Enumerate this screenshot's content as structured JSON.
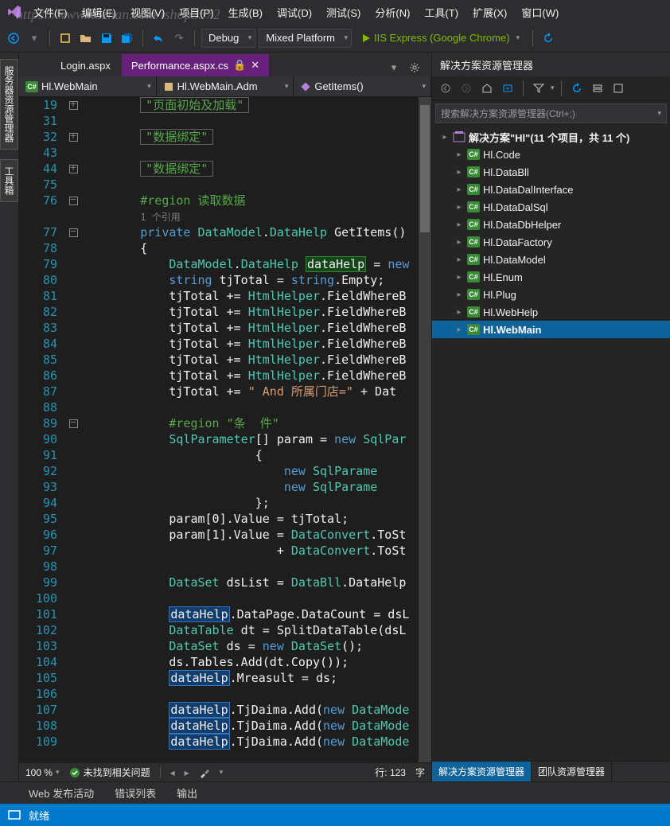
{
  "watermark": "https://www.huzhan.com/ishop3572",
  "menus": [
    "文件(F)",
    "编辑(E)",
    "视图(V)",
    "项目(P)",
    "生成(B)",
    "调试(D)",
    "测试(S)",
    "分析(N)",
    "工具(T)",
    "扩展(X)",
    "窗口(W)"
  ],
  "toolbar": {
    "config": "Debug",
    "platform": "Mixed Platform",
    "run_label": "IIS Express (Google Chrome)"
  },
  "left_rail": [
    "服务器资源管理器",
    "工具箱"
  ],
  "doc_tabs": [
    {
      "label": "Login.aspx",
      "active": false
    },
    {
      "label": "Performance.aspx.cs",
      "active": true
    }
  ],
  "nav": {
    "project": "Hl.WebMain",
    "class": "Hl.WebMain.Adm",
    "member": "GetItems()"
  },
  "editor_status": {
    "zoom": "100 %",
    "issues": "未找到相关问题",
    "line_label": "行:",
    "line": "123",
    "col_label": "字"
  },
  "bottom_tabs": [
    "Web 发布活动",
    "错误列表",
    "输出"
  ],
  "status": "就绪",
  "solution": {
    "title": "解决方案资源管理器",
    "search_placeholder": "搜索解决方案资源管理器(Ctrl+;)",
    "root": "解决方案\"Hl\"(11 个项目，共 11 个)",
    "projects": [
      "Hl.Code",
      "Hl.DataBll",
      "Hl.DataDalInterface",
      "Hl.DataDalSql",
      "Hl.DataDbHelper",
      "Hl.DataFactory",
      "Hl.DataModel",
      "Hl.Enum",
      "Hl.Plug",
      "Hl.WebHelp",
      "Hl.WebMain"
    ],
    "tabs": [
      "解决方案资源管理器",
      "团队资源管理器"
    ]
  },
  "code": {
    "collapsed1": "\"页面初始及加载\"",
    "collapsed2": "\"数据绑定\"",
    "collapsed3": "\"数据绑定\"",
    "region": "#region 读取数据",
    "ref_hint": "1 个引用",
    "inner_region": "#region \"条  件\""
  }
}
